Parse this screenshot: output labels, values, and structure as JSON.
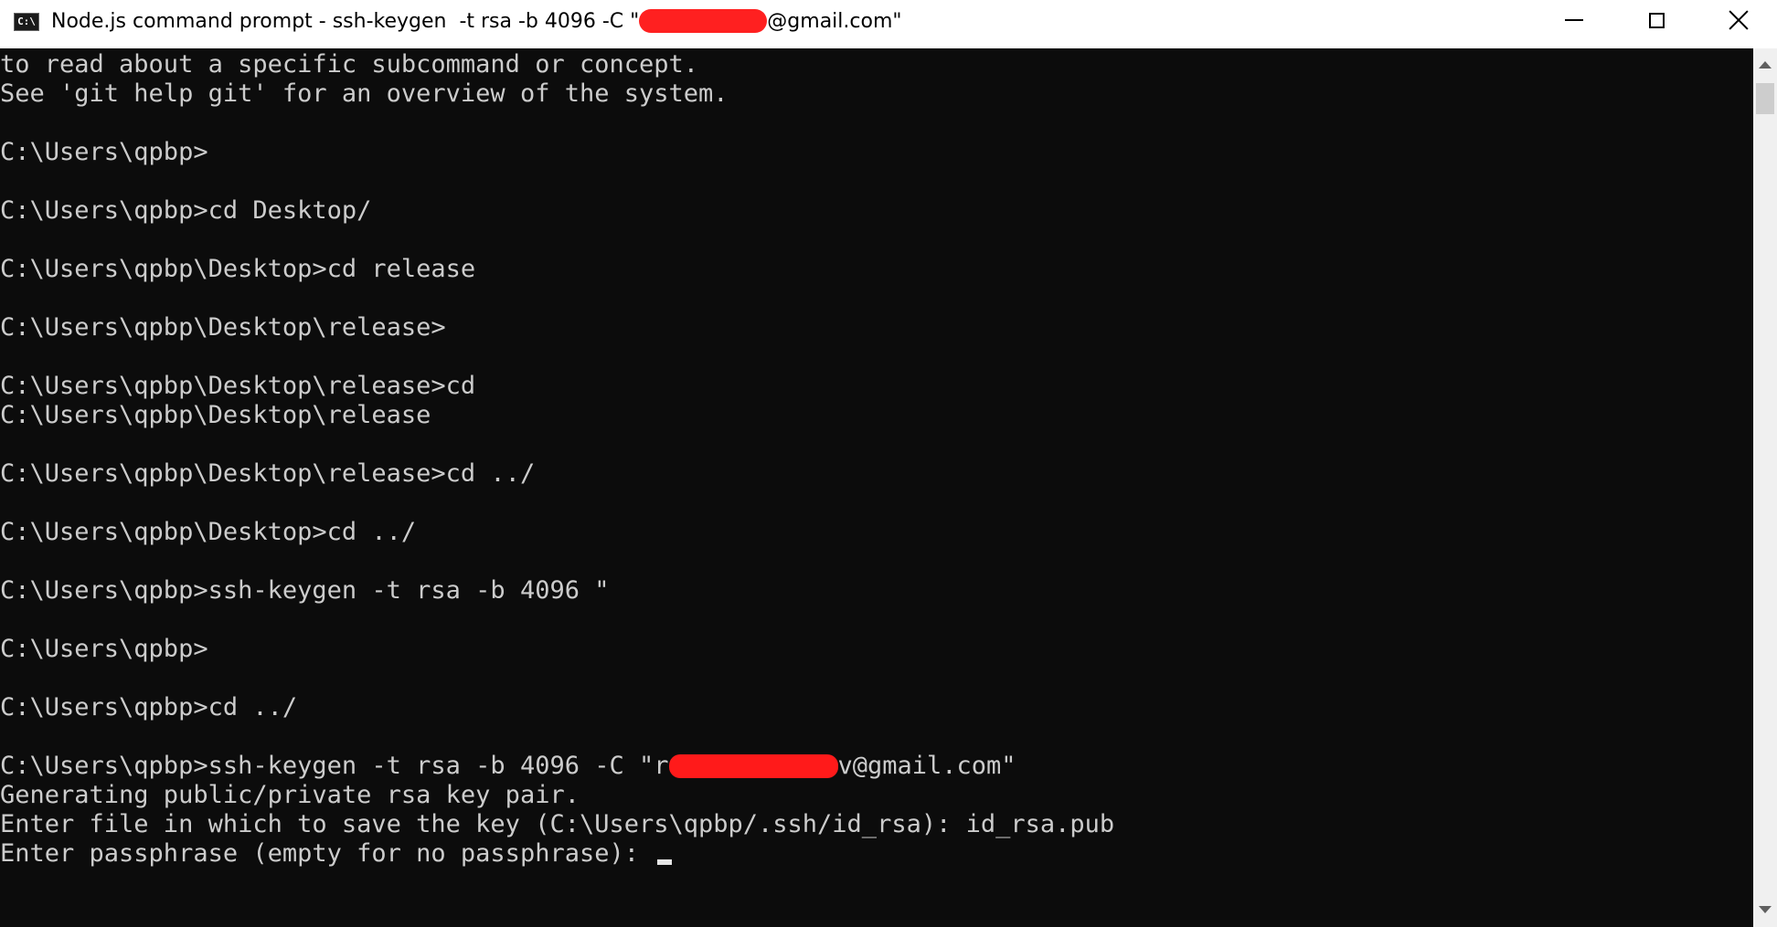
{
  "window": {
    "title_prefix": "Node.js command prompt - ssh-keygen  -t rsa -b 4096 -C \"",
    "title_suffix": "@gmail.com\"",
    "app_icon_text": "C:\\"
  },
  "console": {
    "lines": [
      "to read about a specific subcommand or concept.",
      "See 'git help git' for an overview of the system.",
      "",
      "C:\\Users\\qpbp>",
      "",
      "C:\\Users\\qpbp>cd Desktop/",
      "",
      "C:\\Users\\qpbp\\Desktop>cd release",
      "",
      "C:\\Users\\qpbp\\Desktop\\release>",
      "",
      "C:\\Users\\qpbp\\Desktop\\release>cd",
      "C:\\Users\\qpbp\\Desktop\\release",
      "",
      "C:\\Users\\qpbp\\Desktop\\release>cd ../",
      "",
      "C:\\Users\\qpbp\\Desktop>cd ../",
      "",
      "C:\\Users\\qpbp>ssh-keygen -t rsa -b 4096 \"",
      "",
      "C:\\Users\\qpbp>",
      "",
      "C:\\Users\\qpbp>cd ../",
      ""
    ],
    "keygen_prefix": "C:\\Users\\qpbp>ssh-keygen -t rsa -b 4096 -C \"r",
    "keygen_suffix": "v@gmail.com\"",
    "output_1": "Generating public/private rsa key pair.",
    "output_2": "Enter file in which to save the key (C:\\Users\\qpbp/.ssh/id_rsa): id_rsa.pub",
    "prompt": "Enter passphrase (empty for no passphrase): "
  },
  "colors": {
    "console_bg": "#0c0c0c",
    "console_text": "#cccccc",
    "redaction": "#ff1a1a"
  }
}
